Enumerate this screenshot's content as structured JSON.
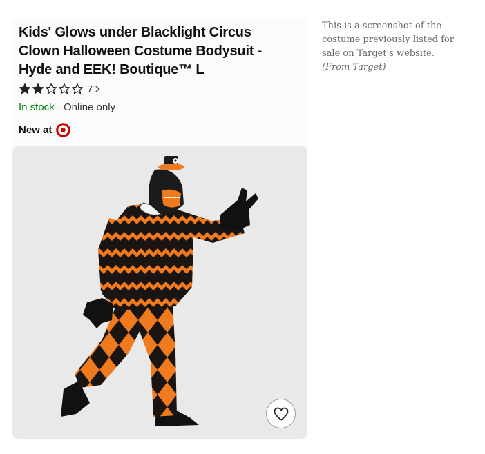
{
  "product": {
    "title": "Kids' Glows under Blacklight Circus Clown Halloween Costume Bodysuit - Hyde and EEK! Boutique™ L",
    "rating": {
      "value": 2,
      "max": 5,
      "count": "7"
    },
    "stock_status": "In stock",
    "availability": " · Online only",
    "new_at_label": "New at",
    "brand_icon": "target-bullseye-icon"
  },
  "favorite": {
    "icon": "heart-icon"
  },
  "caption": {
    "text": "This is a screenshot of the costume previously listed for sale on Target's website.",
    "source": "(From Target)"
  },
  "colors": {
    "stock_green": "#008300",
    "target_red": "#cc0000",
    "costume_orange": "#f07a1e",
    "costume_black": "#1a1412"
  }
}
